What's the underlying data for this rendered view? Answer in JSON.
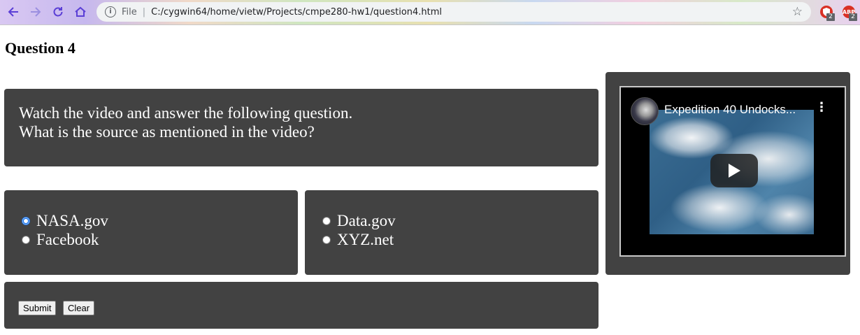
{
  "browser": {
    "scheme_label": "File",
    "url": "C:/cygwin64/home/vietw/Projects/cmpe280-hw1/question4.html",
    "extensions": [
      {
        "name": "ublock",
        "badge": "2"
      },
      {
        "name": "adblock",
        "icon_text": "ABP",
        "badge": "2"
      }
    ]
  },
  "page": {
    "heading": "Question 4",
    "question_line1": "Watch the video and answer the following question.",
    "question_line2": "What is the source as mentioned in the video?"
  },
  "options": {
    "left": [
      {
        "label": "NASA.gov",
        "checked": true
      },
      {
        "label": "Facebook",
        "checked": false
      }
    ],
    "right": [
      {
        "label": "Data.gov",
        "checked": false
      },
      {
        "label": "XYZ.net",
        "checked": false
      }
    ]
  },
  "actions": {
    "submit_label": "Submit",
    "clear_label": "Clear"
  },
  "video": {
    "title": "Expedition 40 Undocks..."
  },
  "colors": {
    "panel": "#424242",
    "text": "#ffffff",
    "accent": "#1a73e8"
  }
}
